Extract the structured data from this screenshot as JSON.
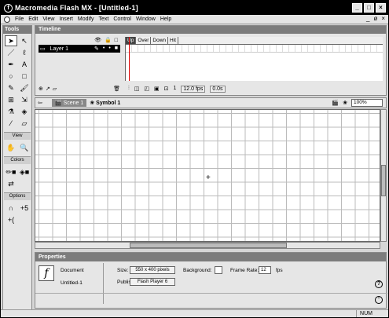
{
  "window": {
    "title": "Macromedia Flash MX - [Untitled-1]",
    "logo": "f"
  },
  "window_buttons": [
    "_",
    "□",
    "×"
  ],
  "menu": [
    "File",
    "Edit",
    "View",
    "Insert",
    "Modify",
    "Text",
    "Control",
    "Window",
    "Help"
  ],
  "mdi_buttons": [
    "_",
    "ø",
    "×"
  ],
  "tools": {
    "header": "Tools",
    "items": [
      {
        "name": "arrow-tool",
        "glyph": "➤"
      },
      {
        "name": "subselect-tool",
        "glyph": "↖"
      },
      {
        "name": "line-tool",
        "glyph": "／"
      },
      {
        "name": "lasso-tool",
        "glyph": "ℓ"
      },
      {
        "name": "pen-tool",
        "glyph": "✒"
      },
      {
        "name": "text-tool",
        "glyph": "A"
      },
      {
        "name": "oval-tool",
        "glyph": "○"
      },
      {
        "name": "rectangle-tool",
        "glyph": "□"
      },
      {
        "name": "pencil-tool",
        "glyph": "✎"
      },
      {
        "name": "brush-tool",
        "glyph": "🖌"
      },
      {
        "name": "free-transform-tool",
        "glyph": "⊞"
      },
      {
        "name": "fill-transform-tool",
        "glyph": "⇲"
      },
      {
        "name": "ink-bottle-tool",
        "glyph": "⚗"
      },
      {
        "name": "paint-bucket-tool",
        "glyph": "◈"
      },
      {
        "name": "eyedropper-tool",
        "glyph": "⁄"
      },
      {
        "name": "eraser-tool",
        "glyph": "▱"
      }
    ],
    "view_label": "View",
    "view_items": [
      {
        "name": "hand-tool",
        "glyph": "✋"
      },
      {
        "name": "zoom-tool",
        "glyph": "🔍"
      }
    ],
    "colors_label": "Colors",
    "color_items": [
      {
        "name": "stroke-color",
        "glyph": "✏■"
      },
      {
        "name": "fill-color",
        "glyph": "◈■"
      },
      {
        "name": "color-swap",
        "glyph": "⇄"
      }
    ],
    "options_label": "Options",
    "option_items": [
      {
        "name": "snap-option",
        "glyph": "∩"
      },
      {
        "name": "smooth-option",
        "glyph": "+5"
      },
      {
        "name": "straighten-option",
        "glyph": "+("
      }
    ]
  },
  "timeline": {
    "header": "Timeline",
    "layer_icons": [
      "👁",
      "🔒",
      "□"
    ],
    "layer_name": "Layer 1",
    "frame_labels": [
      "Up",
      "Over",
      "Down",
      "Hit"
    ],
    "active_frame_label": "Up",
    "current_frame": "1",
    "fps": "12.0 fps",
    "elapsed": "0.0s"
  },
  "editbar": {
    "back_arrow": "⇦",
    "scene_label": "Scene 1",
    "symbol_label": "Symbol 1",
    "zoom": "100%"
  },
  "stage": {
    "crosshair": "+"
  },
  "properties": {
    "header": "Properties",
    "type": "Document",
    "doc_name": "Untitled-1",
    "size_label": "Size:",
    "size_value": "550 x 400 pixels",
    "background_label": "Background:",
    "frame_rate_label": "Frame Rate:",
    "frame_rate_value": "12",
    "fps_unit": "fps",
    "publish_label": "Publish:",
    "publish_value": "Flash Player 6",
    "help_glyph": "?",
    "collapse_glyph": "⌃"
  },
  "statusbar": {
    "num": "NUM"
  }
}
